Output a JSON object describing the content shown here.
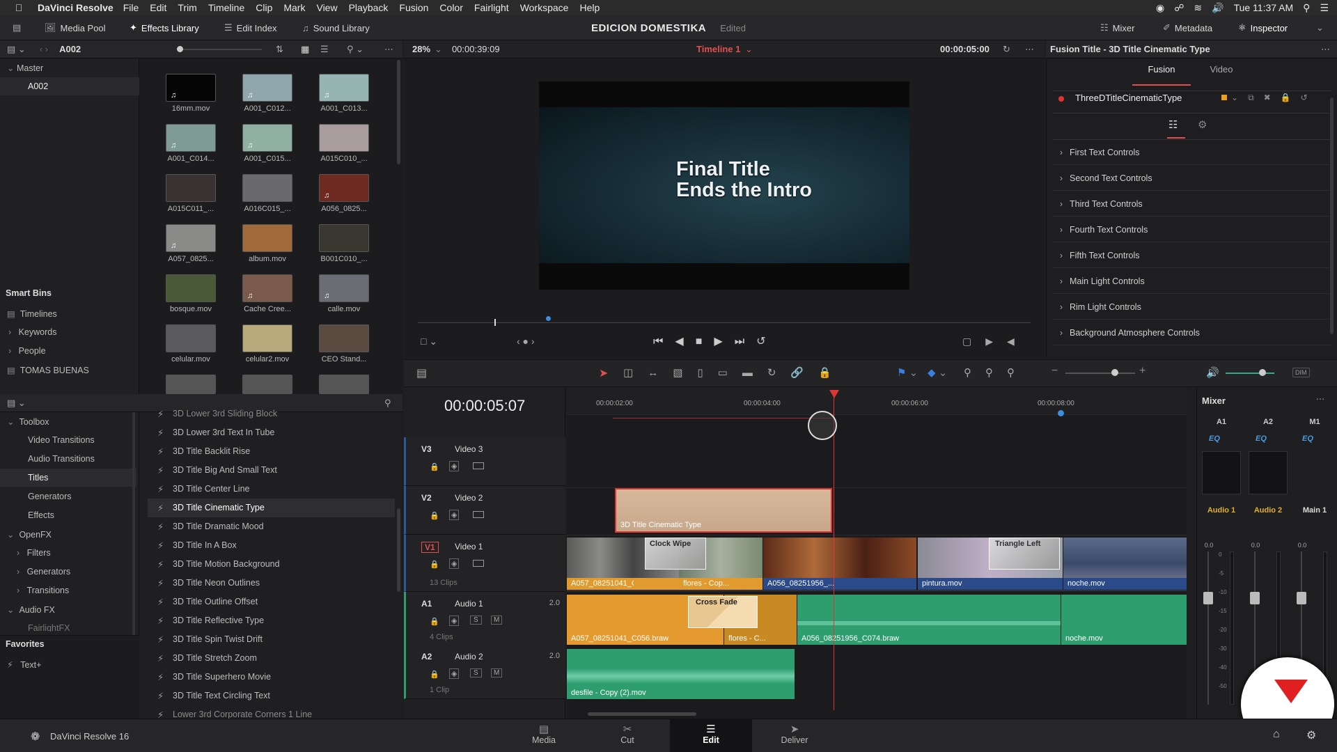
{
  "menubar": {
    "app": "DaVinci Resolve",
    "items": [
      "File",
      "Edit",
      "Trim",
      "Timeline",
      "Clip",
      "Mark",
      "View",
      "Playback",
      "Fusion",
      "Color",
      "Fairlight",
      "Workspace",
      "Help"
    ],
    "clock": "Tue 11:37 AM"
  },
  "toolbar": {
    "media_pool": "Media Pool",
    "effects_library": "Effects Library",
    "edit_index": "Edit Index",
    "sound_library": "Sound Library",
    "mixer": "Mixer",
    "metadata": "Metadata",
    "inspector": "Inspector"
  },
  "project": {
    "name": "EDICION DOMESTIKA",
    "status": "Edited"
  },
  "media_pool": {
    "bin_name": "A002",
    "tree": {
      "master": "Master",
      "bin": "A002"
    },
    "smart_bins": {
      "title": "Smart Bins",
      "items": [
        "Timelines",
        "Keywords",
        "People",
        "TOMAS BUENAS"
      ]
    },
    "clips": [
      {
        "name": "16mm.mov",
        "color": "#050505",
        "audio": true
      },
      {
        "name": "A001_C012...",
        "color": "#8fa6ad",
        "audio": true
      },
      {
        "name": "A001_C013...",
        "color": "#96b4b2",
        "audio": true
      },
      {
        "name": "A001_C014...",
        "color": "#7f9c94",
        "audio": true
      },
      {
        "name": "A001_C015...",
        "color": "#8fb0a2",
        "audio": true
      },
      {
        "name": "A015C010_...",
        "color": "#a89c9e",
        "audio": false
      },
      {
        "name": "A015C011_...",
        "color": "#3a3232",
        "audio": false
      },
      {
        "name": "A016C015_...",
        "color": "#6a6a6e",
        "audio": false
      },
      {
        "name": "A056_0825...",
        "color": "#6e2a20",
        "audio": true
      },
      {
        "name": "A057_0825...",
        "color": "#8a8a88",
        "audio": true
      },
      {
        "name": "album.mov",
        "color": "#a06a3a",
        "audio": false
      },
      {
        "name": "B001C010_...",
        "color": "#3a3630",
        "audio": false
      },
      {
        "name": "bosque.mov",
        "color": "#4a5a38",
        "audio": false
      },
      {
        "name": "Cache Cree...",
        "color": "#7a5a4a",
        "audio": true
      },
      {
        "name": "calle.mov",
        "color": "#6a6e74",
        "audio": true
      },
      {
        "name": "celular.mov",
        "color": "#5a5a5c",
        "audio": false
      },
      {
        "name": "celular2.mov",
        "color": "#b8aa7a",
        "audio": false
      },
      {
        "name": "CEO Stand...",
        "color": "#5a4a40",
        "audio": false
      }
    ]
  },
  "viewer": {
    "zoom": "28%",
    "timecode_left": "00:00:39:09",
    "timeline_name": "Timeline 1",
    "timecode_right": "00:00:05:00",
    "overlay_line1": "Final Title",
    "overlay_line2": "Ends the Intro"
  },
  "effects": {
    "toolbox": "Toolbox",
    "toolbox_items": [
      "Video Transitions",
      "Audio Transitions",
      "Titles",
      "Generators",
      "Effects"
    ],
    "openfx": "OpenFX",
    "openfx_items": [
      "Filters",
      "Generators",
      "Transitions"
    ],
    "audiofx": "Audio FX",
    "audiofx_items": [
      "FairlightFX"
    ],
    "favorites": "Favorites",
    "favorite_items": [
      "Text+"
    ],
    "titles": [
      "3D Lower 3rd Sliding Block",
      "3D Lower 3rd Text In Tube",
      "3D Title Backlit Rise",
      "3D Title Big And Small Text",
      "3D Title Center Line",
      "3D Title Cinematic Type",
      "3D Title Dramatic Mood",
      "3D Title In A Box",
      "3D Title Motion Background",
      "3D Title Neon Outlines",
      "3D Title Outline Offset",
      "3D Title Reflective Type",
      "3D Title Spin Twist Drift",
      "3D Title Stretch Zoom",
      "3D Title Superhero Movie",
      "3D Title Text Circling Text",
      "Lower 3rd Corporate Corners 1 Line"
    ],
    "selected_title": "3D Title Cinematic Type"
  },
  "inspector": {
    "title": "Fusion Title - 3D Title Cinematic Type",
    "tabs": [
      "Fusion",
      "Video"
    ],
    "node_name": "ThreeDTitleCinematicType",
    "sections": [
      "First Text Controls",
      "Second Text Controls",
      "Third Text Controls",
      "Fourth Text Controls",
      "Fifth Text Controls",
      "Main Light Controls",
      "Rim Light Controls",
      "Background Atmosphere Controls"
    ]
  },
  "timeline": {
    "timecode": "00:00:05:07",
    "ruler": [
      "00:00:02:00",
      "00:00:04:00",
      "00:00:06:00",
      "00:00:08:00"
    ],
    "tracks": {
      "v3": {
        "id": "V3",
        "name": "Video 3"
      },
      "v2": {
        "id": "V2",
        "name": "Video 2"
      },
      "v1": {
        "id": "V1",
        "name": "Video 1",
        "count": "13 Clips"
      },
      "a1": {
        "id": "A1",
        "name": "Audio 1",
        "level": "2.0",
        "count": "4 Clips"
      },
      "a2": {
        "id": "A2",
        "name": "Audio 2",
        "level": "2.0",
        "count": "1 Clip"
      }
    },
    "clips": {
      "title": "3D Title Cinematic Type",
      "v1_a": "A057_08251041_C056...",
      "v1_b": "flores - Cop...",
      "v1_c": "A056_08251956_...",
      "v1_d": "pintura.mov",
      "v1_e": "noche.mov",
      "trans_clock": "Clock Wipe",
      "trans_tri": "Triangle Left",
      "a1_a": "A057_08251041_C056.braw",
      "a1_b": "flores - C...",
      "a1_c": "A056_08251956_C074.braw",
      "a1_d": "noche.mov",
      "a1_trans": "Cross Fade",
      "a2_a": "desfile - Copy (2).mov"
    },
    "s": "S",
    "m": "M"
  },
  "mixer": {
    "title": "Mixer",
    "channels": [
      "A1",
      "A2",
      "M1"
    ],
    "names": [
      "Audio 1",
      "Audio 2",
      "Main 1"
    ],
    "eq": "EQ",
    "scale": [
      "0",
      "-5",
      "-10",
      "-15",
      "-20",
      "-30",
      "-40",
      "-50"
    ],
    "dim": "DIM",
    "zero": "0.0"
  },
  "pages": {
    "brand": "DaVinci Resolve 16",
    "tabs": [
      "Media",
      "Cut",
      "Edit",
      "Deliver"
    ],
    "active": "Edit"
  }
}
